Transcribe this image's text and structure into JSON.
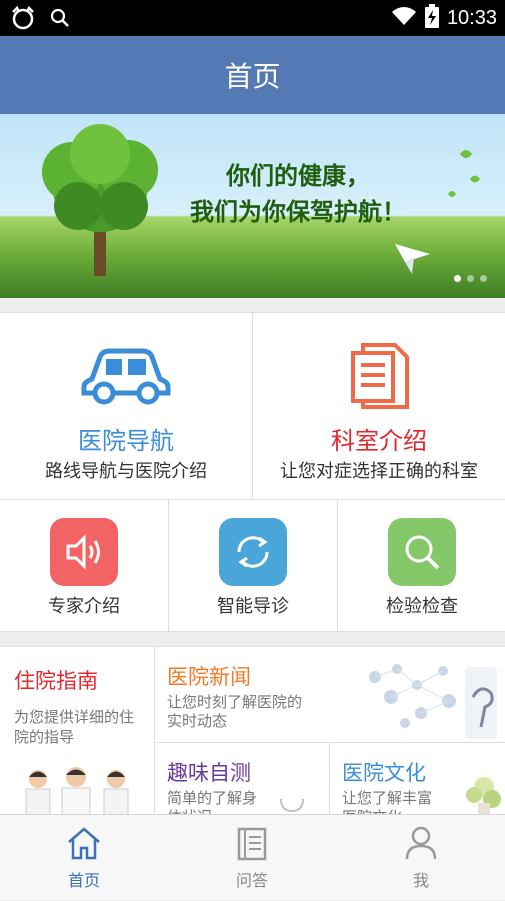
{
  "status_bar": {
    "time": "10:33",
    "icons": [
      "cat-icon",
      "search-icon",
      "wifi-icon",
      "battery-charging-icon"
    ]
  },
  "header": {
    "title": "首页"
  },
  "banner": {
    "slogan_line1": "你们的健康，",
    "slogan_line2": "我们为你保驾护航！",
    "dots": 3,
    "active_dot": 0
  },
  "features_main": [
    {
      "title": "医院导航",
      "subtitle": "路线导航与医院介绍",
      "icon": "car-icon",
      "color": "#3a8ed8"
    },
    {
      "title": "科室介绍",
      "subtitle": "让您对症选择正确的科室",
      "icon": "document-icon",
      "color": "#e0282e"
    }
  ],
  "features_small": [
    {
      "label": "专家介绍",
      "icon": "speaker-icon",
      "color": "#f26464"
    },
    {
      "label": "智能导诊",
      "icon": "refresh-icon",
      "color": "#4aa5d8"
    },
    {
      "label": "检验检查",
      "icon": "search-icon",
      "color": "#84c86a"
    }
  ],
  "info_cards": {
    "hospital_guide": {
      "title": "住院指南",
      "desc": "为您提供详细的住院的指导",
      "color": "#e0282e"
    },
    "news": {
      "title": "医院新闻",
      "desc": "让您时刻了解医院的实时动态",
      "color": "#f07a2a"
    },
    "self_test": {
      "title": "趣味自测",
      "desc": "简单的了解身体状况",
      "color": "#6a3aa0"
    },
    "culture": {
      "title": "医院文化",
      "desc": "让您了解丰富医院文化",
      "color": "#3a8ed8"
    }
  },
  "tabbar": {
    "tabs": [
      {
        "label": "首页",
        "icon": "home-icon",
        "active": true
      },
      {
        "label": "问答",
        "icon": "notebook-icon",
        "active": false
      },
      {
        "label": "我",
        "icon": "person-icon",
        "active": false
      }
    ]
  }
}
